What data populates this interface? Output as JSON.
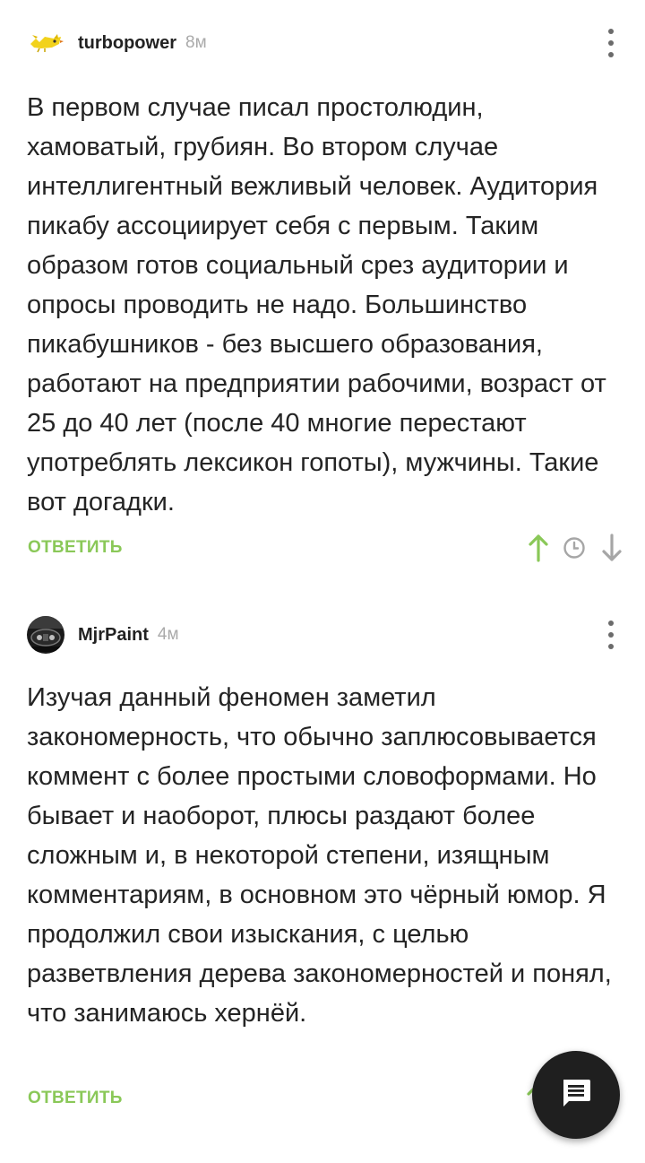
{
  "comments": [
    {
      "username": "turbopower",
      "time": "8м",
      "avatar_icon": "yellow-bird-avatar-icon",
      "text": "В первом случае писал простолюдин, хамоватый, грубиян. Во втором случае интеллигентный вежливый человек. Аудитория пикабу ассоциирует себя с первым. Таким образом готов социальный срез аудитории и опросы проводить не надо. Большинство пикабушников - без высшего образования, работают на предприятии рабочими, возраст от 25 до 40 лет (после 40 многие перестают употреблять лексикон гопоты), мужчины. Такие вот догадки.",
      "reply_label": "ОТВЕТИТЬ"
    },
    {
      "username": "MjrPaint",
      "time": "4м",
      "avatar_icon": "car-interior-avatar-icon",
      "text": "Изучая данный феномен заметил закономерность, что обычно заплюсовывается коммент с более простыми словоформами. Но бывает и наоборот, плюсы раздают более сложным и, в некоторой степени, изящным комментариям, в основном это чёрный юмор. Я продолжил свои изыскания, с целью разветвления дерева закономерностей и понял, что занимаюсь хернёй.",
      "reply_label": "ОТВЕТИТЬ"
    }
  ],
  "colors": {
    "accent_green": "#8ac858",
    "icon_gray": "#a6a6a6",
    "fab_background": "#1f1f1f"
  },
  "icons": {
    "more": "more-vertical-icon",
    "upvote": "arrow-up-icon",
    "save": "clock-icon",
    "downvote": "arrow-down-icon",
    "fab": "comment-icon"
  }
}
